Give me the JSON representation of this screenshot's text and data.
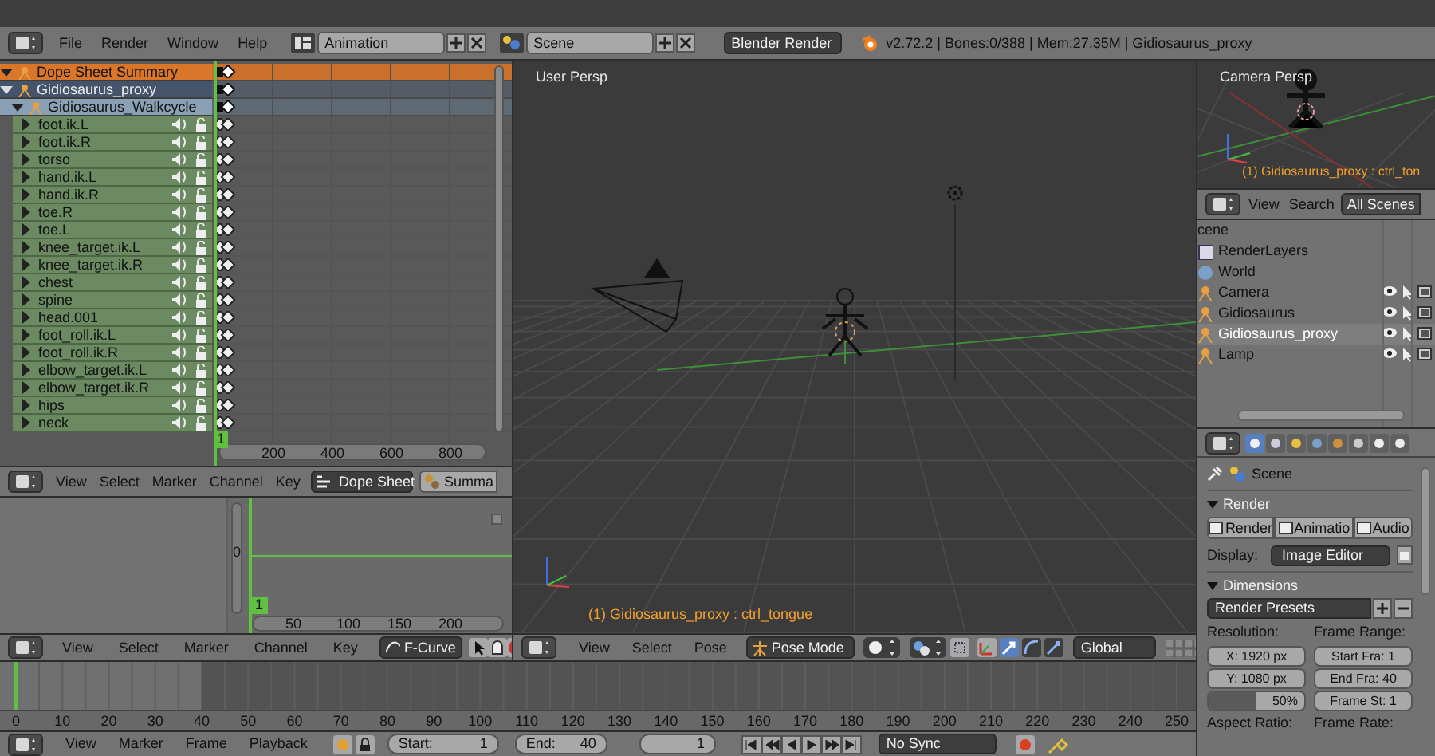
{
  "info_header": {
    "menus": [
      "File",
      "Render",
      "Window",
      "Help"
    ],
    "screen_layout": "Animation",
    "scene": "Scene",
    "render_engine": "Blender Render",
    "stats": "v2.72.2 | Bones:0/388 | Mem:27.35M | Gidiosaurus_proxy"
  },
  "dope_sheet": {
    "summary": {
      "name": "Dope Sheet Summary",
      "expanded": true
    },
    "object": {
      "name": "Gidiosaurus_proxy",
      "expanded": true
    },
    "action": {
      "name": "Gidiosaurus_Walkcycle",
      "expanded": true
    },
    "channels": [
      {
        "name": "foot.ik.L",
        "expanded": false
      },
      {
        "name": "foot.ik.R",
        "expanded": false
      },
      {
        "name": "torso",
        "expanded": false
      },
      {
        "name": "hand.ik.L",
        "expanded": false
      },
      {
        "name": "hand.ik.R",
        "expanded": false
      },
      {
        "name": "toe.R",
        "expanded": false
      },
      {
        "name": "toe.L",
        "expanded": false
      },
      {
        "name": "knee_target.ik.L",
        "expanded": false
      },
      {
        "name": "knee_target.ik.R",
        "expanded": false
      },
      {
        "name": "chest",
        "expanded": false
      },
      {
        "name": "spine",
        "expanded": false
      },
      {
        "name": "head.001",
        "expanded": false
      },
      {
        "name": "foot_roll.ik.L",
        "expanded": false
      },
      {
        "name": "foot_roll.ik.R",
        "expanded": false
      },
      {
        "name": "elbow_target.ik.L",
        "expanded": false
      },
      {
        "name": "elbow_target.ik.R",
        "expanded": false
      },
      {
        "name": "hips",
        "expanded": false
      },
      {
        "name": "neck",
        "expanded": false
      }
    ],
    "current_frame": "1",
    "ruler": [
      "200",
      "400",
      "600",
      "800"
    ]
  },
  "dope_sheet_header": {
    "menus": [
      "View",
      "Select",
      "Marker",
      "Channel",
      "Key"
    ],
    "mode": "Dope Sheet",
    "filter": "Summa"
  },
  "graph_editor": {
    "value_label": "0",
    "current_frame": "1",
    "ruler": [
      "50",
      "100",
      "150",
      "200"
    ]
  },
  "graph_header": {
    "menus": [
      "View",
      "Select",
      "Marker",
      "Channel",
      "Key"
    ],
    "mode": "F-Curve"
  },
  "viewport": {
    "title": "User Persp",
    "status": "(1) Gidiosaurus_proxy : ctrl_tongue"
  },
  "viewport_header": {
    "menus": [
      "View",
      "Select",
      "Pose"
    ],
    "mode": "Pose Mode",
    "orientation": "Global"
  },
  "camera_view": {
    "title": "Camera Persp",
    "status": "(1) Gidiosaurus_proxy : ctrl_ton"
  },
  "outliner": {
    "menus": [
      "View",
      "Search"
    ],
    "filter": "All Scenes",
    "root": "cene",
    "items": [
      {
        "name": "RenderLayers",
        "kind": "layers",
        "selected": false
      },
      {
        "name": "World",
        "kind": "world",
        "selected": false
      },
      {
        "name": "Camera",
        "kind": "object",
        "selected": false
      },
      {
        "name": "Gidiosaurus",
        "kind": "object",
        "selected": false
      },
      {
        "name": "Gidiosaurus_proxy",
        "kind": "object",
        "selected": true
      },
      {
        "name": "Lamp",
        "kind": "object",
        "selected": false
      }
    ]
  },
  "properties": {
    "context": "Scene",
    "render_panel": {
      "title": "Render",
      "buttons": [
        "Render",
        "Animatio",
        "Audio"
      ],
      "display_label": "Display:",
      "display": "Image Editor"
    },
    "dimensions_panel": {
      "title": "Dimensions",
      "presets": "Render Presets",
      "resolution_label": "Resolution:",
      "x": "X:  1920 px",
      "y": "Y:  1080 px",
      "percentage": {
        "text": "50%",
        "level": 0.5
      },
      "frame_range_label": "Frame Range:",
      "start": "Start Fra:  1",
      "end": "End Fra:  40",
      "step": "Frame St:  1",
      "aspect_label": "Aspect Ratio:",
      "rate_label": "Frame Rate:"
    }
  },
  "timeline": {
    "ticks": [
      "0",
      "10",
      "20",
      "30",
      "40",
      "50",
      "60",
      "70",
      "80",
      "90",
      "100",
      "110",
      "120",
      "130",
      "140",
      "150",
      "160",
      "170",
      "180",
      "190",
      "200",
      "210",
      "220",
      "230",
      "240",
      "250"
    ]
  },
  "timeline_header": {
    "menus": [
      "View",
      "Marker",
      "Frame",
      "Playback"
    ],
    "start_label": "Start:",
    "start": "1",
    "end_label": "End:",
    "end": "40",
    "current": "1",
    "sync": "No Sync"
  }
}
